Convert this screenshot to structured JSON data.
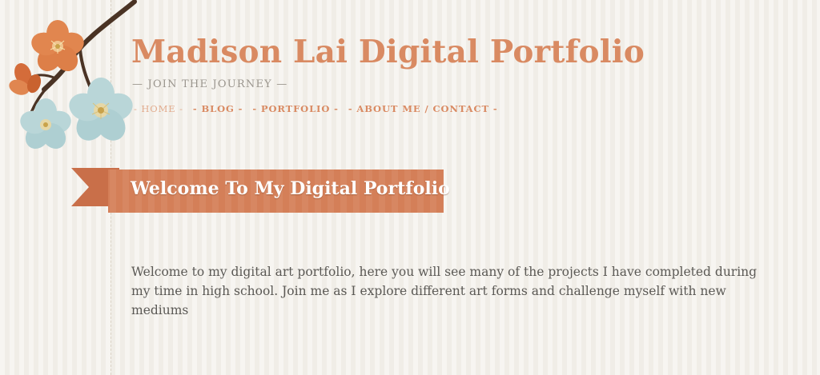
{
  "site": {
    "title": "Madison Lai Digital Portfolio",
    "tagline": "— JOIN THE JOURNEY —"
  },
  "nav": {
    "items": [
      {
        "label": "- HOME -",
        "active": true
      },
      {
        "label": "- BLOG -",
        "active": false
      },
      {
        "label": "- PORTFOLIO -",
        "active": false
      },
      {
        "label": "- ABOUT ME / CONTACT -",
        "active": false
      }
    ]
  },
  "main": {
    "heading": "Welcome To My Digital Portfolio",
    "intro": "Welcome to my digital art portfolio, here you will see many of the projects I have completed during my time in high school. Join me as I explore different art forms and challenge myself with new mediums"
  },
  "colors": {
    "accent": "#d98a62",
    "ribbon": "#d47f58",
    "background": "#f3f0ea",
    "text": "#5b5955",
    "flower_blue": "#b9d6d8"
  }
}
